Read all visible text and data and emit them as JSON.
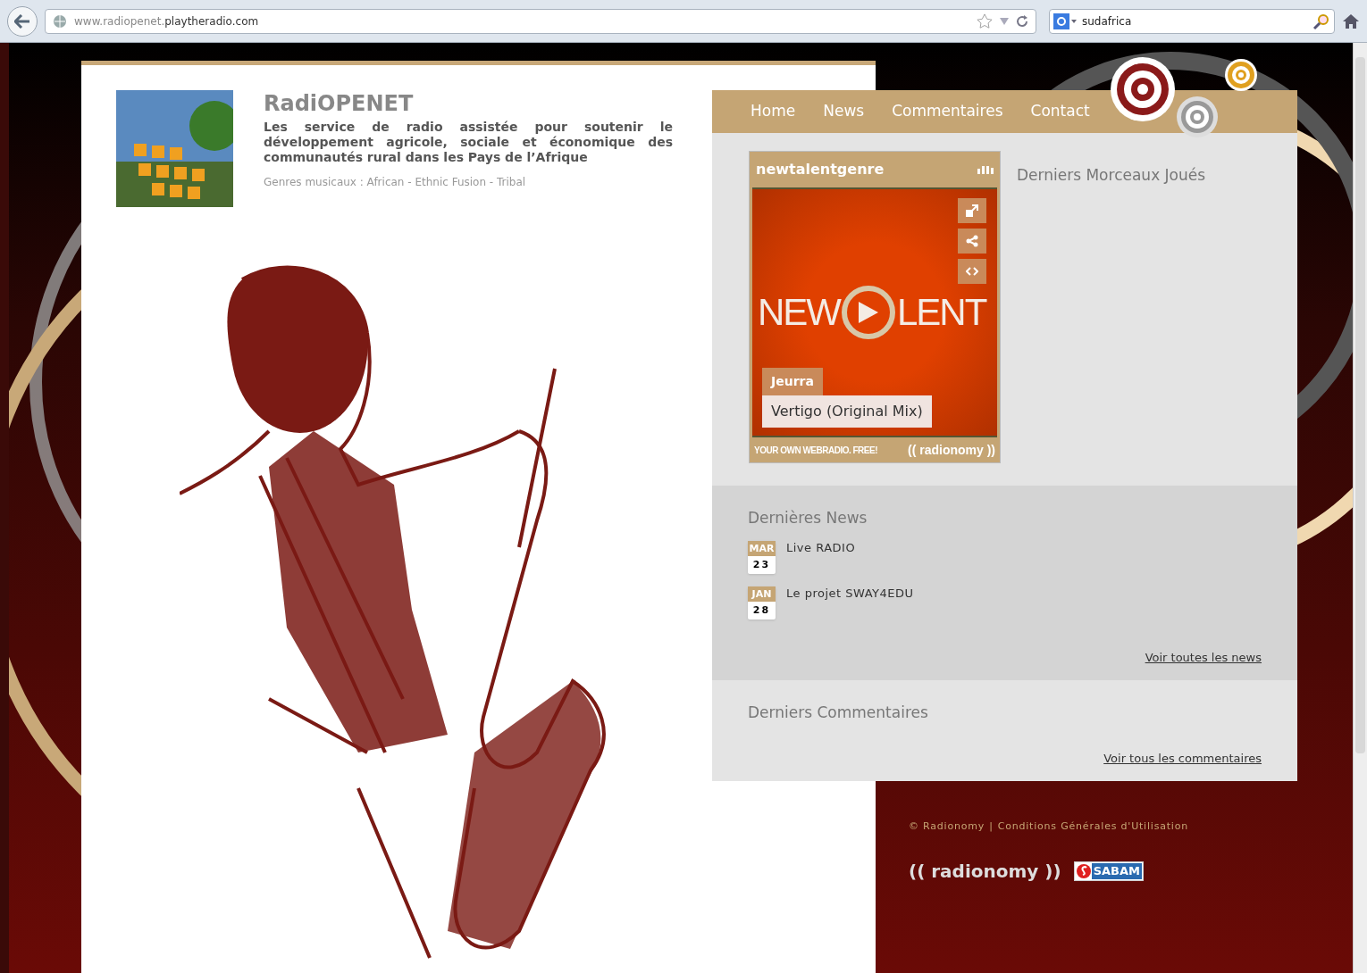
{
  "browser": {
    "url_prefix": "www.radiopenet.",
    "url_domain": "playtheradio.com",
    "search_value": "sudafrica"
  },
  "header": {
    "title": "RadiOPENET",
    "description": "Les service de radio assistée pour soutenir le développement agricole, sociale et économique des communautés rural dans les Pays de l’Afrique",
    "genres": "Genres musicaux : African - Ethnic Fusion - Tribal"
  },
  "nav": [
    "Home",
    "News",
    "Commentaires",
    "Contact"
  ],
  "player": {
    "station": "newtalentgenre",
    "cover_text": [
      "NEW",
      "LENT"
    ],
    "artist": "Jeurra",
    "track": "Vertigo (Original Mix)",
    "tagline": "YOUR OWN WEBRADIO. FREE!",
    "brand": "(( radionomy ))"
  },
  "recent_tracks": {
    "title": "Derniers Morceaux Joués"
  },
  "news": {
    "title": "Dernières News",
    "items": [
      {
        "month": "MAR",
        "day": "23",
        "title": "Live RADIO"
      },
      {
        "month": "JAN",
        "day": "28",
        "title": "Le projet SWAY4EDU"
      }
    ],
    "more": "Voir toutes les news"
  },
  "comments": {
    "title": "Derniers Commentaires",
    "more": "Voir tous les commentaires"
  },
  "footer": {
    "links": [
      "© Radionomy",
      "Conditions Générales d'Utilisation"
    ],
    "separator": "|",
    "logo_text": "(( radionomy ))",
    "sabam_text": "SABAM"
  }
}
